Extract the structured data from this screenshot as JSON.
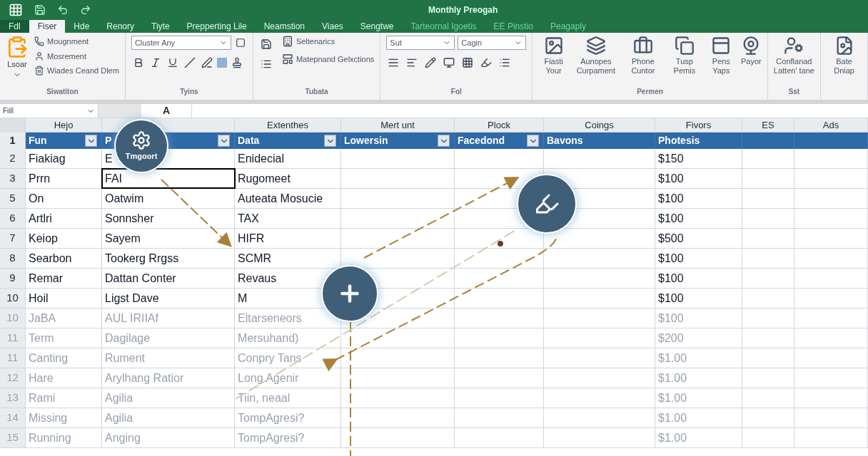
{
  "window": {
    "title": "Monthly Preogah"
  },
  "tabs": [
    {
      "label": "Fdl",
      "kind": "file",
      "selected": false
    },
    {
      "label": "Fiser",
      "kind": "tab",
      "selected": true
    },
    {
      "label": "Hde",
      "kind": "tab",
      "selected": false
    },
    {
      "label": "Renory",
      "kind": "tab",
      "selected": false
    },
    {
      "label": "Tiyte",
      "kind": "tab",
      "selected": false
    },
    {
      "label": "Prepperting Lile",
      "kind": "tab",
      "selected": false
    },
    {
      "label": "Neamstion",
      "kind": "tab",
      "selected": false
    },
    {
      "label": "Viaes",
      "kind": "tab",
      "selected": false
    },
    {
      "label": "Sengtwe",
      "kind": "tab",
      "selected": false
    },
    {
      "label": "Tarteornal Igoetis",
      "kind": "faint",
      "selected": false
    },
    {
      "label": "EE Pinstio",
      "kind": "faint",
      "selected": false
    },
    {
      "label": "Peagaply",
      "kind": "faint",
      "selected": false
    }
  ],
  "ribbon": [
    {
      "kind": "clipboard",
      "label": "Siwatiton",
      "items": [
        "Lsoar",
        "Mougnment",
        "Mosrement",
        "Wiades Ceand Dlem"
      ]
    },
    {
      "kind": "font",
      "label": "Tyins",
      "items": [
        "Cluster Any"
      ]
    },
    {
      "kind": "table",
      "label": "Tubata",
      "items": [
        "Seltenarics",
        "Matepnand Gelxctions"
      ]
    },
    {
      "kind": "fill",
      "label": "Fol",
      "items": [
        "Sut",
        "Cagin"
      ]
    },
    {
      "kind": "insert",
      "label": "Permen",
      "items": [
        "Fiasti Your",
        "Aunopes Curpament",
        "Phone Cuntor",
        "Tusp Pemis",
        "Pens Yaps",
        "Payor"
      ]
    },
    {
      "kind": "insert",
      "label": "Sst",
      "items": [
        "Conflanad Latten' tane"
      ]
    },
    {
      "kind": "insert",
      "items": [
        "Bate Dniap"
      ]
    }
  ],
  "formula_bar": {
    "name_box": "Fiill",
    "function_label": "A"
  },
  "columns": [
    {
      "label": "Hejo"
    },
    {},
    {
      "label": "Extenthes"
    },
    {
      "label": "Mert unt"
    },
    {
      "label": "Plock"
    },
    {
      "label": "Coings"
    },
    {
      "label": "Fivors"
    },
    {
      "label": "ES"
    },
    {
      "label": "Ads"
    }
  ],
  "header_row": {
    "number": "1",
    "cells": [
      {
        "label": "Fun",
        "filter": true
      },
      {
        "label": "P",
        "filter": true
      },
      {
        "label": "Data",
        "filter": true
      },
      {
        "label": "Lowersin",
        "filter": true
      },
      {
        "label": "Facedond",
        "filter": true
      },
      {
        "label": "Bavons",
        "filter": false
      },
      {
        "label": "Photesis",
        "filter": false
      },
      {
        "filter": false
      },
      {
        "filter": false
      }
    ]
  },
  "rows": [
    {
      "number": "2",
      "faded": false,
      "cells": [
        {
          "text": "Fiakiag",
          "selected": false
        },
        {
          "text": "E",
          "selected": false
        },
        {
          "text": "Enidecial",
          "selected": false
        },
        {
          "text": "$150",
          "selected": false
        }
      ]
    },
    {
      "number": "3",
      "faded": false,
      "cells": [
        {
          "text": "Prrn",
          "selected": false
        },
        {
          "text": "FAI",
          "selected": true
        },
        {
          "text": "Rugomeet",
          "selected": false
        },
        {
          "text": "$100",
          "selected": false
        }
      ]
    },
    {
      "number": "5",
      "faded": false,
      "cells": [
        {
          "text": "On",
          "selected": false
        },
        {
          "text": "Oatwim",
          "selected": false
        },
        {
          "text": "Auteata Mosucie",
          "selected": false
        },
        {
          "text": "$100",
          "selected": false
        }
      ]
    },
    {
      "number": "6",
      "faded": false,
      "cells": [
        {
          "text": "Artlri",
          "selected": false
        },
        {
          "text": "Sonnsher",
          "selected": false
        },
        {
          "text": "TAX",
          "selected": false
        },
        {
          "text": "$100",
          "selected": false
        }
      ]
    },
    {
      "number": "7",
      "faded": false,
      "cells": [
        {
          "text": "Keiop",
          "selected": false
        },
        {
          "text": "Sayem",
          "selected": false
        },
        {
          "text": "HIFR",
          "selected": false
        },
        {
          "text": "$500",
          "selected": false
        }
      ]
    },
    {
      "number": "8",
      "faded": false,
      "cells": [
        {
          "text": "Searbon",
          "selected": false
        },
        {
          "text": "Tookerg Rrgss",
          "selected": false
        },
        {
          "text": "SCMR",
          "selected": false
        },
        {
          "text": "$100",
          "selected": false
        }
      ]
    },
    {
      "number": "9",
      "faded": false,
      "cells": [
        {
          "text": "Remar",
          "selected": false
        },
        {
          "text": "Dattan Conter",
          "selected": false
        },
        {
          "text": "Revaus",
          "selected": false
        },
        {
          "text": "$100",
          "selected": false
        }
      ]
    },
    {
      "number": "10",
      "faded": false,
      "cells": [
        {
          "text": "Hoil",
          "selected": false
        },
        {
          "text": "Ligst Dave",
          "selected": false
        },
        {
          "text": "M",
          "selected": false
        },
        {
          "text": "$100",
          "selected": false
        }
      ]
    },
    {
      "number": "10",
      "faded": true,
      "cells": [
        {
          "text": "JaBA",
          "selected": false
        },
        {
          "text": "AUL IRIIAf",
          "selected": false
        },
        {
          "text": "Eltarseneors",
          "selected": false
        },
        {
          "text": "$100",
          "selected": false
        }
      ]
    },
    {
      "number": "11",
      "faded": true,
      "cells": [
        {
          "text": "Term",
          "selected": false
        },
        {
          "text": "Dagilage",
          "selected": false
        },
        {
          "text": "Mersuhand)",
          "selected": false
        },
        {
          "text": "$200",
          "selected": false
        }
      ]
    },
    {
      "number": "11",
      "faded": true,
      "cells": [
        {
          "text": "Canting",
          "selected": false
        },
        {
          "text": "Rument",
          "selected": false
        },
        {
          "text": "Conpry Tans",
          "selected": false
        },
        {
          "text": "$1.00",
          "selected": false
        }
      ]
    },
    {
      "number": "12",
      "faded": true,
      "cells": [
        {
          "text": "Hare",
          "selected": false
        },
        {
          "text": "Arylhang Ratior",
          "selected": false
        },
        {
          "text": "Long Agenir",
          "selected": false
        },
        {
          "text": "$1.00",
          "selected": false
        }
      ]
    },
    {
      "number": "13",
      "faded": true,
      "cells": [
        {
          "text": "Rami",
          "selected": false
        },
        {
          "text": "Agilia",
          "selected": false
        },
        {
          "text": "Tiin, neaal",
          "selected": false
        },
        {
          "text": "$1.00",
          "selected": false
        }
      ]
    },
    {
      "number": "14",
      "faded": true,
      "cells": [
        {
          "text": "Missing",
          "selected": false
        },
        {
          "text": "Agilia",
          "selected": false
        },
        {
          "text": "TompAgresi?",
          "selected": false
        },
        {
          "text": "$1.00",
          "selected": false
        }
      ]
    },
    {
      "number": "15",
      "faded": true,
      "cells": [
        {
          "text": "Running",
          "selected": false
        },
        {
          "text": "Anging",
          "selected": false
        },
        {
          "text": "TompAgresi?",
          "selected": false
        },
        {
          "text": "$1.00",
          "selected": false
        }
      ]
    }
  ],
  "overlays": [
    {
      "kind": "gear",
      "label": "Tmgoort"
    },
    {
      "kind": "marker"
    },
    {
      "kind": "plus"
    }
  ]
}
